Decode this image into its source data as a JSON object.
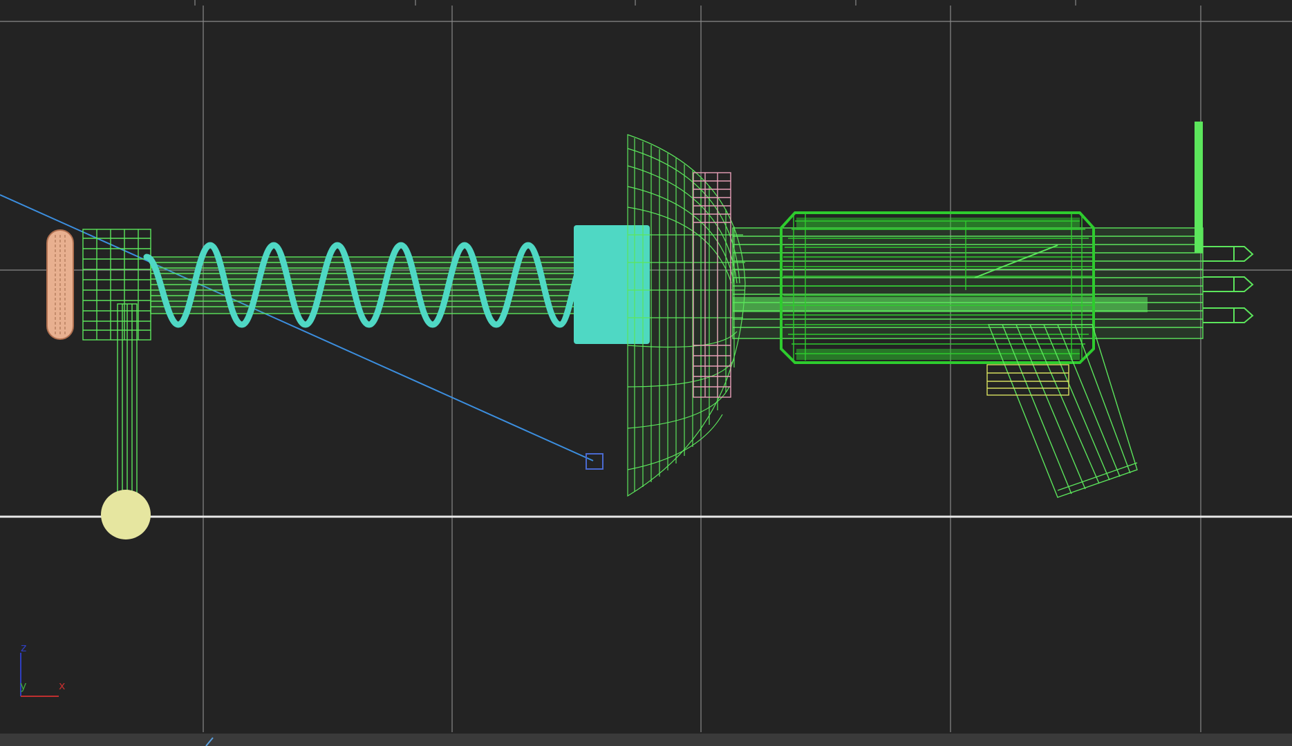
{
  "viewport": {
    "background": "#232323",
    "grid_color": "#8a8a8a",
    "ground_line_color": "#e8e8e8"
  },
  "axis_gizmo": {
    "z_label": "z",
    "y_label": "y",
    "x_label": "x",
    "z_color": "#2f3fbf",
    "y_color": "#3fa83f",
    "x_color": "#bf2f2f"
  },
  "colors": {
    "wire_green": "#5ce65c",
    "wire_dark_green": "#2ecc2e",
    "spring_cyan": "#4fd8c4",
    "pink": "#e8a0b8",
    "peach": "#e8b090",
    "pale_yellow": "#e6e6a0",
    "yellow_wire": "#d8e060",
    "target_line": "#3c8fe0",
    "target_box": "#4a6ad0"
  }
}
